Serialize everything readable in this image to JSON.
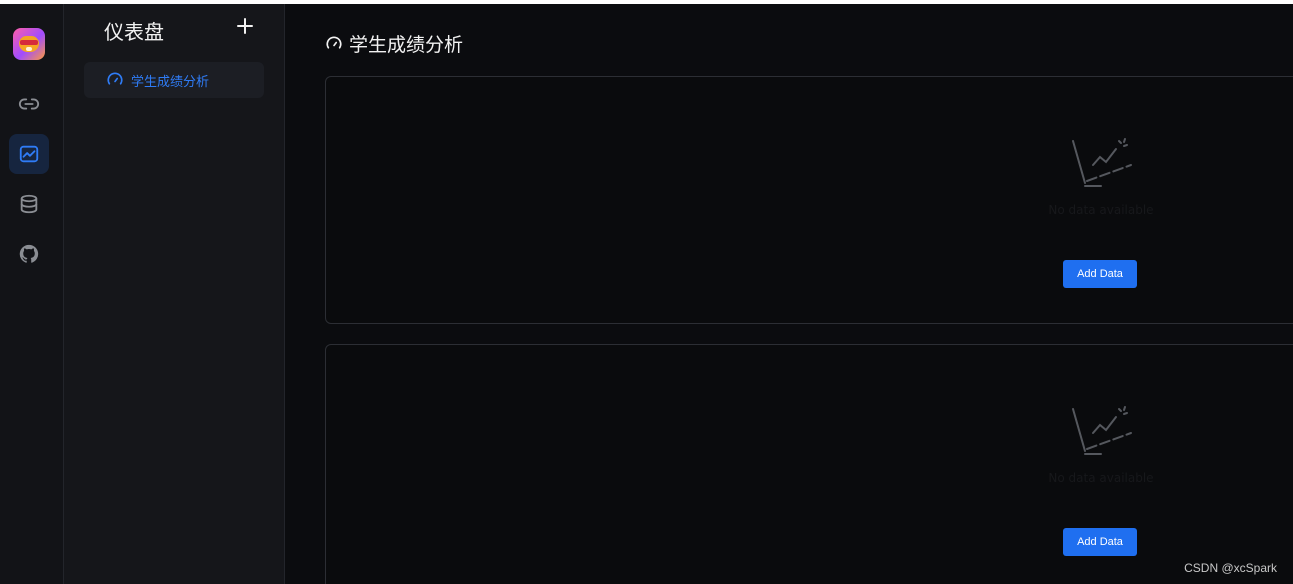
{
  "rail": {
    "logo": "app-logo",
    "items": [
      {
        "icon": "link-icon",
        "active": false
      },
      {
        "icon": "dashboard-chart-icon",
        "active": true
      },
      {
        "icon": "database-icon",
        "active": false
      },
      {
        "icon": "github-icon",
        "active": false
      }
    ],
    "accent_color": "#2f7cf6"
  },
  "sidebar": {
    "title": "仪表盘",
    "add_icon": "plus-icon",
    "items": [
      {
        "label": "学生成绩分析",
        "icon": "gauge-icon",
        "active": true
      }
    ]
  },
  "main": {
    "title": "学生成绩分析",
    "title_icon": "gauge-icon",
    "panels": [
      {
        "empty_icon": "empty-chart-icon",
        "empty_text": "No data available",
        "button_label": "Add Data"
      },
      {
        "empty_icon": "empty-chart-icon",
        "empty_text": "No data available",
        "button_label": "Add Data"
      }
    ]
  },
  "watermark": "CSDN @xcSpark",
  "colors": {
    "background": "#0b0c0f",
    "rail_bg": "#121317",
    "sidebar_bg": "#15161a",
    "button_blue": "#1f6ff0"
  }
}
